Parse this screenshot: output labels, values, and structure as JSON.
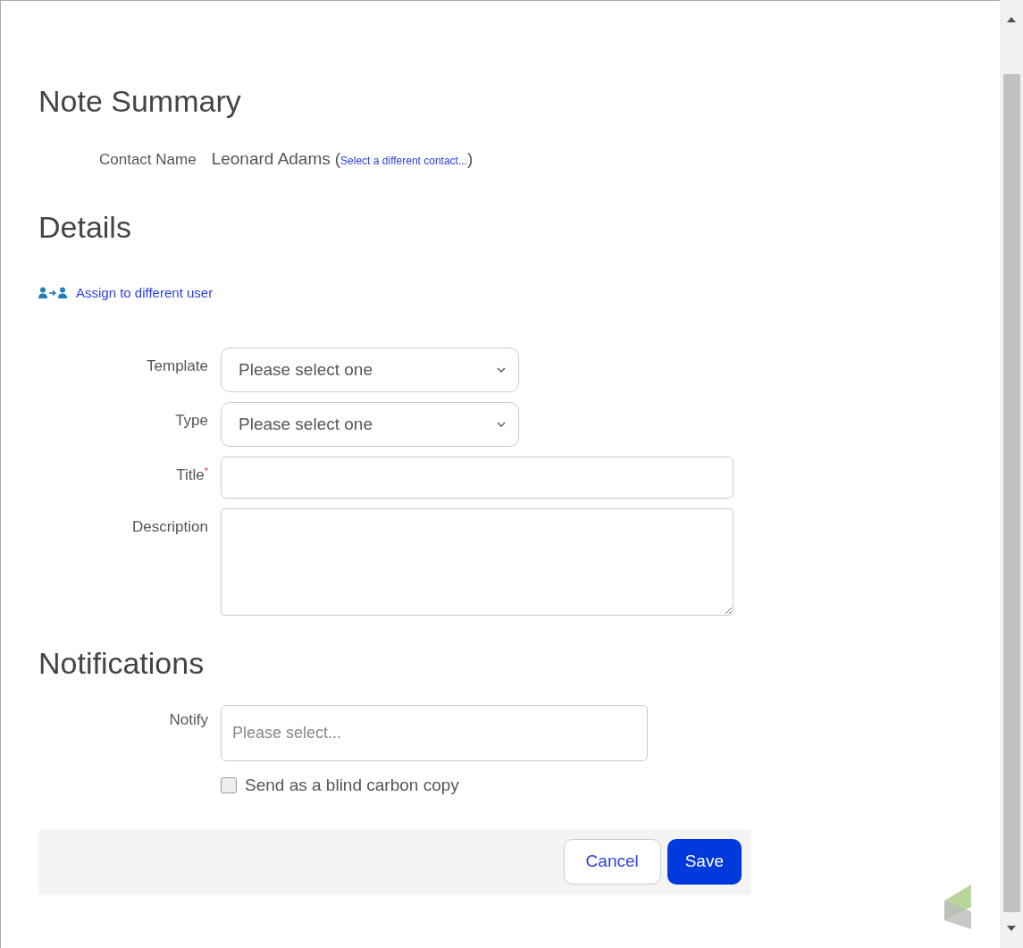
{
  "summary": {
    "heading": "Note Summary",
    "contact_label": "Contact Name",
    "contact_name": "Leonard Adams",
    "open_paren": "(",
    "change_link": "Select a different contact...",
    "close_paren": ")"
  },
  "details": {
    "heading": "Details",
    "assign_link": "Assign to different user",
    "fields": [
      {
        "kind": "select",
        "label": "Template",
        "value": "Please select one"
      },
      {
        "kind": "select",
        "label": "Type",
        "value": "Please select one"
      },
      {
        "kind": "text",
        "label": "Title",
        "required_mark": "*"
      },
      {
        "kind": "textarea",
        "label": "Description"
      }
    ]
  },
  "notifications": {
    "heading": "Notifications",
    "notify_label": "Notify",
    "notify_placeholder": "Please select...",
    "bcc": {
      "label": "Send as a blind carbon copy",
      "checked": false
    }
  },
  "buttons": [
    {
      "kind": "secondary",
      "label": "Cancel"
    },
    {
      "kind": "primary",
      "label": "Save"
    }
  ]
}
